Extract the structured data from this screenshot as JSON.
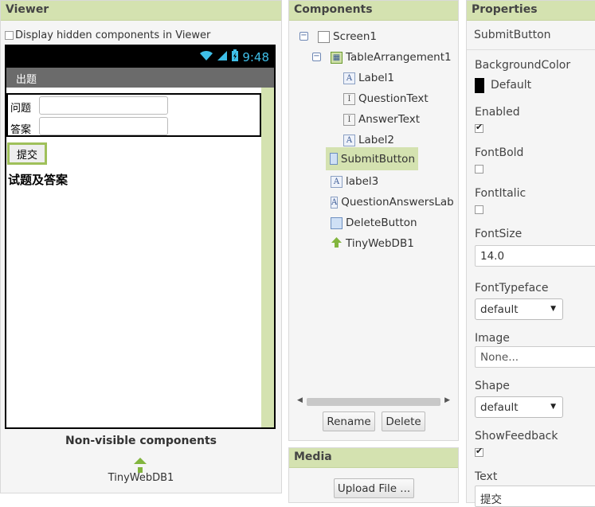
{
  "viewer": {
    "header": "Viewer",
    "hidden_components_label": "Display hidden components in Viewer",
    "phone": {
      "time": "9:48",
      "screen_title": "出题",
      "question_label": "问题",
      "answer_label": "答案",
      "submit_label": "提交",
      "label3_text": "试题及答案"
    },
    "nonvisible_title": "Non-visible components",
    "nonvisible_items": [
      "TinyWebDB1"
    ]
  },
  "components": {
    "header": "Components",
    "tree": [
      {
        "name": "Screen1",
        "icon": "screen-icon"
      },
      {
        "name": "TableArrangement1",
        "icon": "table-arrangement-icon"
      },
      {
        "name": "Label1",
        "icon": "label-icon"
      },
      {
        "name": "QuestionText",
        "icon": "textbox-icon"
      },
      {
        "name": "AnswerText",
        "icon": "textbox-icon"
      },
      {
        "name": "Label2",
        "icon": "label-icon"
      },
      {
        "name": "SubmitButton",
        "icon": "button-icon"
      },
      {
        "name": "label3",
        "icon": "label-icon"
      },
      {
        "name": "QuestionAnswersLabe",
        "icon": "label-icon"
      },
      {
        "name": "DeleteButton",
        "icon": "button-icon"
      },
      {
        "name": "TinyWebDB1",
        "icon": "tinywebdb-icon"
      }
    ],
    "selected": "SubmitButton",
    "rename_label": "Rename",
    "delete_label": "Delete"
  },
  "media": {
    "header": "Media",
    "upload_label": "Upload File ..."
  },
  "properties": {
    "header": "Properties",
    "component_name": "SubmitButton",
    "background_color_label": "BackgroundColor",
    "background_color_value": "Default",
    "enabled_label": "Enabled",
    "enabled_checked": true,
    "font_bold_label": "FontBold",
    "font_bold_checked": false,
    "font_italic_label": "FontItalic",
    "font_italic_checked": false,
    "font_size_label": "FontSize",
    "font_size_value": "14.0",
    "font_typeface_label": "FontTypeface",
    "font_typeface_value": "default",
    "image_label": "Image",
    "image_value": "None...",
    "shape_label": "Shape",
    "shape_value": "default",
    "show_feedback_label": "ShowFeedback",
    "show_feedback_checked": true,
    "text_label": "Text",
    "text_value": "提交"
  },
  "colors": {
    "header_bg": "#d4e2b0",
    "selected_bg": "#d4e2b0",
    "phone_title_bg": "#6b6b6b",
    "accent_green": "#82b53e"
  }
}
